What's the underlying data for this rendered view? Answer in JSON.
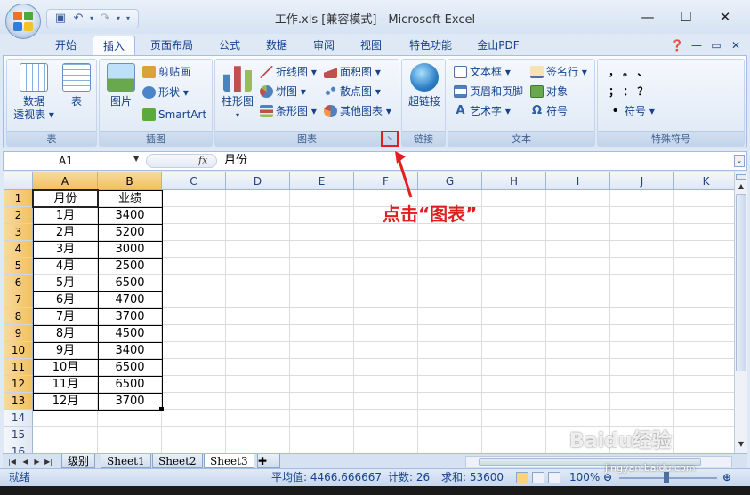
{
  "window": {
    "title": "工作.xls  [兼容模式] - Microsoft Excel",
    "minimize": "—",
    "maximize": "☐",
    "close": "✕"
  },
  "tabs": [
    "开始",
    "插入",
    "页面布局",
    "公式",
    "数据",
    "审阅",
    "视图",
    "特色功能",
    "金山PDF"
  ],
  "active_tab": "插入",
  "ribbon": {
    "table_group": {
      "label": "表",
      "pivot": "数据\n透视表",
      "pivot_l1": "数据",
      "pivot_l2": "透视表 ▾",
      "table": "表"
    },
    "illus_group": {
      "label": "插图",
      "picture": "图片",
      "clipart": "剪贴画",
      "shapes": "形状 ▾",
      "smartart": "SmartArt"
    },
    "chart_group": {
      "label": "图表",
      "column": "柱形图",
      "column_arrow": "▾",
      "line": "折线图 ▾",
      "area": "面积图 ▾",
      "pie": "饼图 ▾",
      "scatter": "散点图 ▾",
      "bar": "条形图 ▾",
      "other": "其他图表 ▾"
    },
    "link_group": {
      "label": "链接",
      "hyperlink": "超链接"
    },
    "text_group": {
      "label": "文本",
      "textbox": "文本框 ▾",
      "header_footer": "页眉和页脚",
      "wordart": "艺术字 ▾",
      "signature": "签名行 ▾",
      "object": "对象",
      "symbol": "符号"
    },
    "special_group": {
      "label": "特殊符号",
      "row1": "，  。  、",
      "row2": "；  ：  ？",
      "symbol": "符号 ▾"
    }
  },
  "formula_bar": {
    "name_box": "A1",
    "fx": "fx",
    "content": "月份"
  },
  "columns": [
    "A",
    "B",
    "C",
    "D",
    "E",
    "F",
    "G",
    "H",
    "I",
    "J",
    "K"
  ],
  "rows": [
    "1",
    "2",
    "3",
    "4",
    "5",
    "6",
    "7",
    "8",
    "9",
    "10",
    "11",
    "12",
    "13",
    "14",
    "15",
    "16"
  ],
  "table": {
    "header": [
      "月份",
      "业绩"
    ],
    "data": [
      [
        "1月",
        "3400"
      ],
      [
        "2月",
        "5200"
      ],
      [
        "3月",
        "3000"
      ],
      [
        "4月",
        "2500"
      ],
      [
        "5月",
        "6500"
      ],
      [
        "6月",
        "4700"
      ],
      [
        "7月",
        "3700"
      ],
      [
        "8月",
        "4500"
      ],
      [
        "9月",
        "3400"
      ],
      [
        "10月",
        "6500"
      ],
      [
        "11月",
        "6500"
      ],
      [
        "12月",
        "3700"
      ]
    ]
  },
  "sheet_tabs": [
    "级别",
    "Sheet1",
    "Sheet2",
    "Sheet3"
  ],
  "active_sheet": "Sheet3",
  "status": {
    "ready": "就绪",
    "average": "平均值: 4466.666667",
    "count": "计数: 26",
    "sum": "求和: 53600",
    "zoom": "100%"
  },
  "annotation": "点击“图表”",
  "watermark": "Baidu经验",
  "watermark_url": "jingyan.baidu.com",
  "colors": {
    "accent": "#e02020",
    "selected_header": "#f1c15f"
  }
}
